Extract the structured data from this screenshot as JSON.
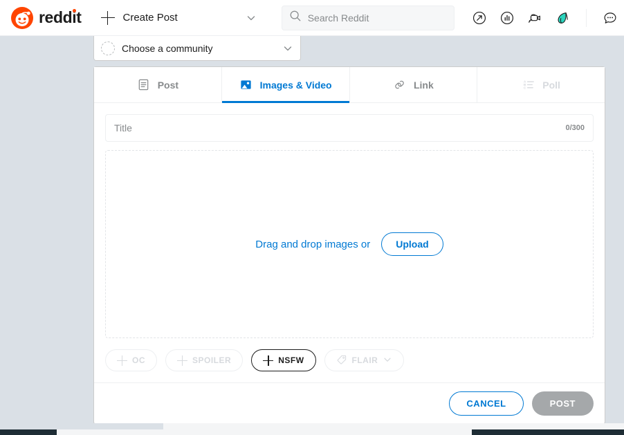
{
  "colors": {
    "accent_blue": "#0079d3",
    "brand_orange": "#ff4500",
    "page_bg": "#dae0e6",
    "muted_text": "#878a8c",
    "disabled_text": "#d7dade",
    "post_button_bg": "#a5a8aa"
  },
  "topbar": {
    "brand_name": "reddit",
    "brand_icon": "reddit-alien-logo",
    "create_post_label": "Create Post",
    "create_post_icon": "plus-icon",
    "nav_caret_icon": "chevron-down-icon",
    "search": {
      "placeholder": "Search Reddit",
      "value": "",
      "icon": "search-icon"
    },
    "icons": [
      {
        "name": "popular-icon",
        "title": "Popular"
      },
      {
        "name": "chart-icon",
        "title": "Analytics"
      },
      {
        "name": "live-video-icon",
        "title": "Live"
      },
      {
        "name": "comet-badge-icon",
        "title": "Badge"
      },
      {
        "name": "chat-bubble-icon",
        "title": "Chat"
      }
    ]
  },
  "community_selector": {
    "label": "Choose a community",
    "avatar_icon": "community-avatar-icon",
    "caret_icon": "chevron-down-icon"
  },
  "tabs": [
    {
      "label": "Post",
      "icon": "document-lines-icon",
      "state": "inactive"
    },
    {
      "label": "Images & Video",
      "icon": "image-icon",
      "state": "active"
    },
    {
      "label": "Link",
      "icon": "link-chain-icon",
      "state": "inactive"
    },
    {
      "label": "Poll",
      "icon": "poll-list-icon",
      "state": "disabled"
    }
  ],
  "title_field": {
    "placeholder": "Title",
    "value": "",
    "char_count": "0/300"
  },
  "dropzone": {
    "text": "Drag and drop images or",
    "upload_label": "Upload"
  },
  "tags": [
    {
      "label": "OC",
      "icon": "plus-icon",
      "state": "disabled"
    },
    {
      "label": "SPOILER",
      "icon": "plus-icon",
      "state": "disabled"
    },
    {
      "label": "NSFW",
      "icon": "plus-icon",
      "state": "enabled"
    },
    {
      "label": "FLAIR",
      "icon": "tag-icon",
      "state": "disabled",
      "caret_icon": "chevron-down-icon"
    }
  ],
  "footer": {
    "cancel_label": "CANCEL",
    "post_label": "POST"
  }
}
